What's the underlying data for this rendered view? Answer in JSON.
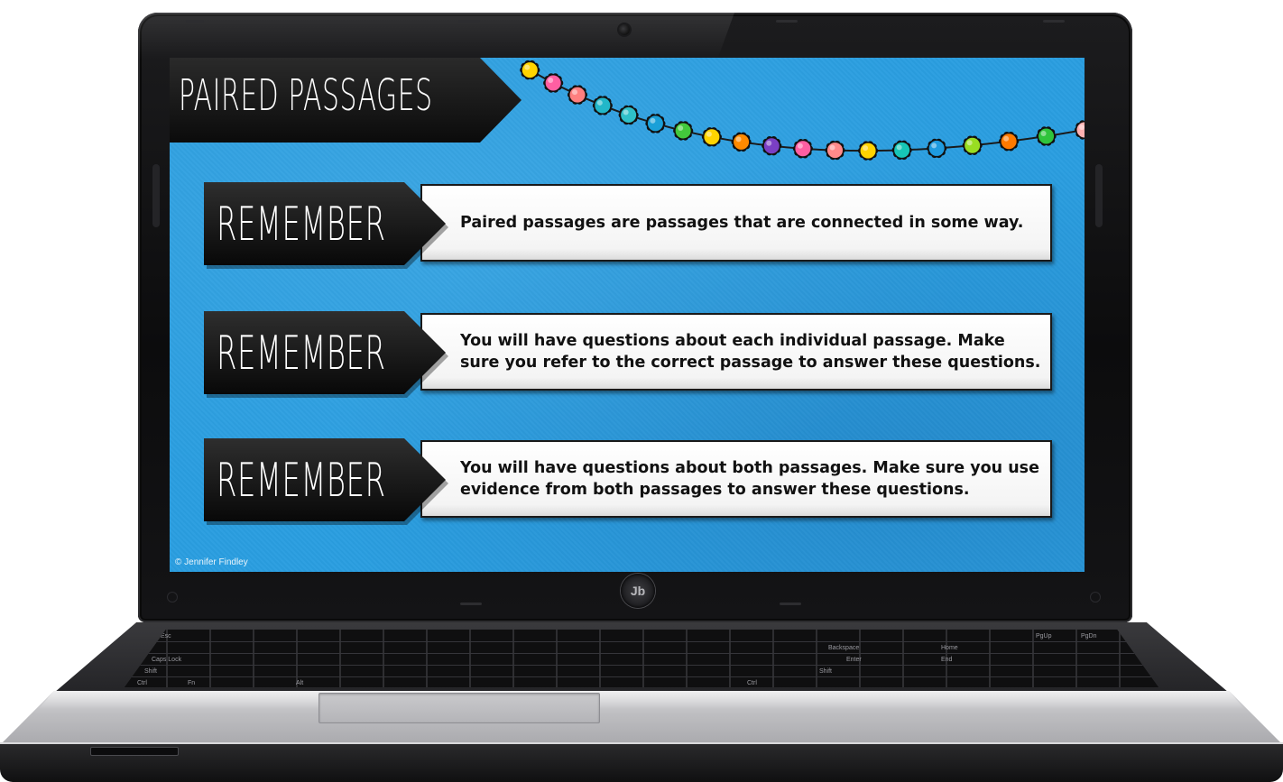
{
  "slide": {
    "title": "PAIRED PASSAGES",
    "rows": [
      {
        "tag": "REMEMBER",
        "text": "Paired passages are passages that are connected in some way."
      },
      {
        "tag": "REMEMBER",
        "text": "You will have questions about each individual passage. Make sure you refer to the correct passage to answer these questions."
      },
      {
        "tag": "REMEMBER",
        "text": "You will have questions about both passages. Make sure you use evidence from both passages to answer these questions."
      }
    ],
    "copyright": "© Jennifer Findley",
    "background_color": "#2a9ee0",
    "pompom_colors": [
      "#ffd400",
      "#ff5fa2",
      "#ff7f7f",
      "#22b7c9",
      "#2fc0c8",
      "#1aa0d8",
      "#43c83c",
      "#ffd400",
      "#ff8a00",
      "#7b3fc4",
      "#ff5fa2",
      "#ff8a8a",
      "#ffd400",
      "#17c6b6",
      "#1e9be0",
      "#99dd22",
      "#ff7a00",
      "#2fc43c",
      "#ffb0b0"
    ]
  },
  "laptop": {
    "badge_label": "Jb",
    "keyboard_labels": [
      "Esc",
      "Caps Lock",
      "Shift",
      "Ctrl",
      "Fn",
      "Alt",
      "Backspace",
      "Enter",
      "Shift",
      "Ctrl",
      "Home",
      "End",
      "PgUp",
      "PgDn"
    ]
  }
}
